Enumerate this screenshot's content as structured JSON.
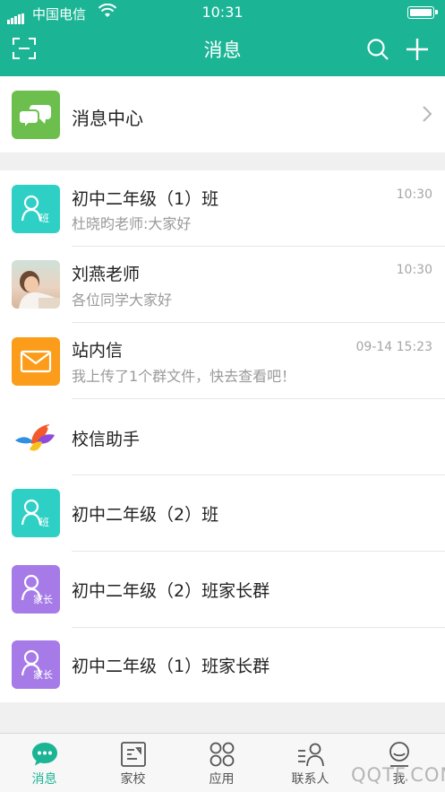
{
  "status_bar": {
    "carrier": "中国电信",
    "time": "10:31"
  },
  "nav": {
    "title": "消息"
  },
  "message_center": {
    "label": "消息中心"
  },
  "conversations": [
    {
      "title": "初中二年级（1）班",
      "preview": "杜晓昀老师:大家好",
      "time": "10:30",
      "avatar_icon": "class-icon",
      "avatar_text": "班"
    },
    {
      "title": "刘燕老师",
      "preview": "各位同学大家好",
      "time": "10:30",
      "avatar_icon": "teacher-photo"
    },
    {
      "title": "站内信",
      "preview": "我上传了1个群文件，快去查看吧！",
      "time": "09-14 15:23",
      "avatar_icon": "mail-icon"
    },
    {
      "title": "校信助手",
      "avatar_icon": "bird-logo"
    },
    {
      "title": "初中二年级（2）班",
      "avatar_icon": "class-icon",
      "avatar_text": "班"
    },
    {
      "title": "初中二年级（2）班家长群",
      "avatar_icon": "parent-icon",
      "avatar_text": "家长"
    },
    {
      "title": "初中二年级（1）班家长群",
      "avatar_icon": "parent-icon",
      "avatar_text": "家长"
    }
  ],
  "tabbar": [
    {
      "label": "消息",
      "active": true
    },
    {
      "label": "家校"
    },
    {
      "label": "应用"
    },
    {
      "label": "联系人"
    },
    {
      "label": "我"
    }
  ],
  "watermark": "QQTF.COM",
  "colors": {
    "accent": "#1bb596",
    "message_center_icon": "#6cbf4d",
    "class_icon": "#2ed0c5",
    "mail_icon": "#fb9d1a",
    "parent_icon": "#a67be8"
  }
}
